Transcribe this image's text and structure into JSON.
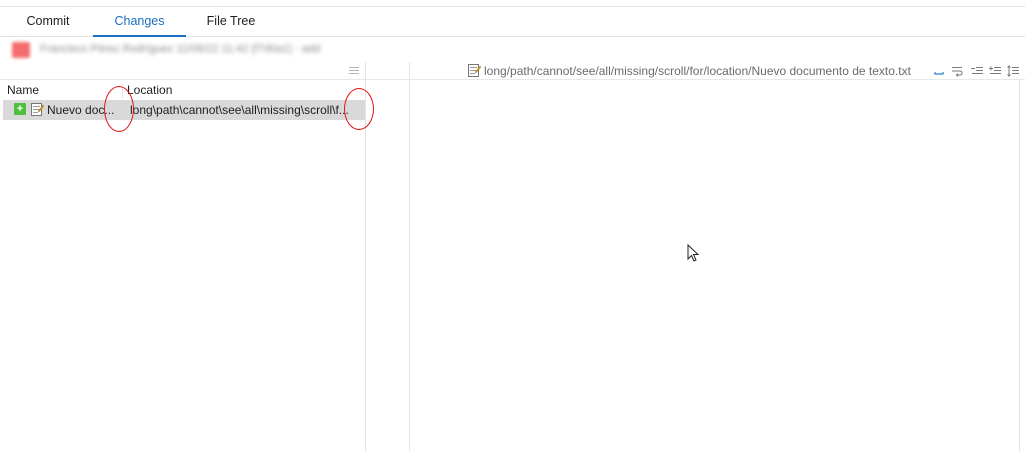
{
  "tabs": [
    {
      "label": "Commit",
      "active": false
    },
    {
      "label": "Changes",
      "active": true
    },
    {
      "label": "File Tree",
      "active": false
    }
  ],
  "commit": {
    "summary": "Francisco Pérez Rodríguez  11/08/22 11:42 (f7d0a1) · add"
  },
  "file_list": {
    "columns": {
      "name": "Name",
      "location": "Location"
    },
    "rows": [
      {
        "status": "added",
        "name": "Nuevo doc...",
        "location": "long\\path\\cannot\\see\\all\\missing\\scroll\\f..."
      }
    ]
  },
  "diff_view": {
    "path": "long/path/cannot/see/all/missing/scroll/for/location/Nuevo documento de texto.txt"
  },
  "icons": [
    "menu-icon",
    "add-status-icon",
    "text-file-icon",
    "whitespace-icon",
    "wrap-icon",
    "unindent-icon",
    "indent-icon",
    "line-spacing-icon",
    "mouse-cursor-icon"
  ],
  "colors": {
    "accent": "#1a6fbf",
    "added": "#4fbf3f",
    "annotation": "#e01010",
    "selected_row": "#d9d9d9"
  }
}
